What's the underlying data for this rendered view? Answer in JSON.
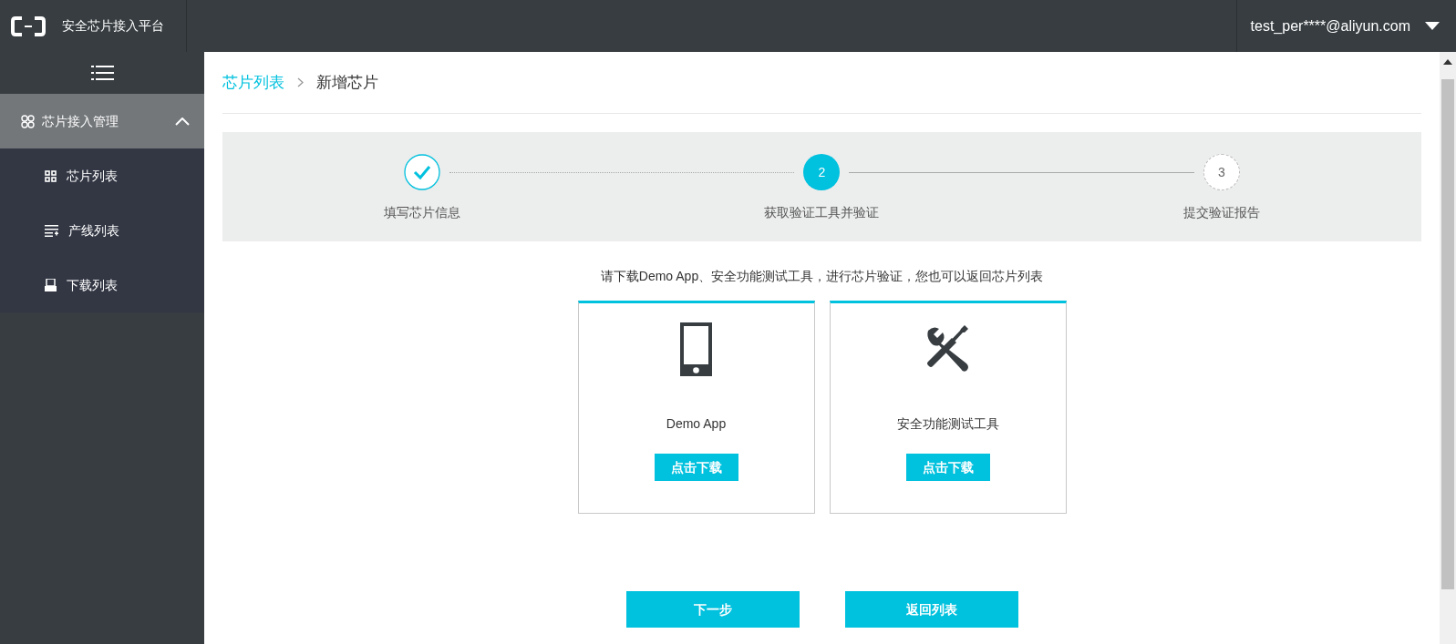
{
  "header": {
    "title": "安全芯片接入平台",
    "user": "test_per****@aliyun.com"
  },
  "sidebar": {
    "group": {
      "label": "芯片接入管理",
      "expanded": true
    },
    "items": [
      {
        "label": "芯片列表",
        "kind": "grid"
      },
      {
        "label": "产线列表",
        "kind": "list"
      },
      {
        "label": "下载列表",
        "kind": "printer"
      }
    ]
  },
  "breadcrumb": [
    {
      "label": "芯片列表",
      "kind": "link"
    },
    {
      "label": "新增芯片",
      "kind": "current"
    }
  ],
  "steps": [
    {
      "label": "填写芯片信息",
      "kind": "done"
    },
    {
      "number": "2",
      "label": "获取验证工具并验证",
      "kind": "active"
    },
    {
      "number": "3",
      "label": "提交验证报告",
      "kind": "pending"
    }
  ],
  "intro": "请下载Demo App、安全功能测试工具，进行芯片验证，您也可以返回芯片列表",
  "cards": [
    {
      "kind": "phone",
      "title": "Demo App",
      "button": "点击下载"
    },
    {
      "kind": "tools",
      "title": "安全功能测试工具",
      "button": "点击下载"
    }
  ],
  "actions": [
    "下一步",
    "返回列表"
  ]
}
